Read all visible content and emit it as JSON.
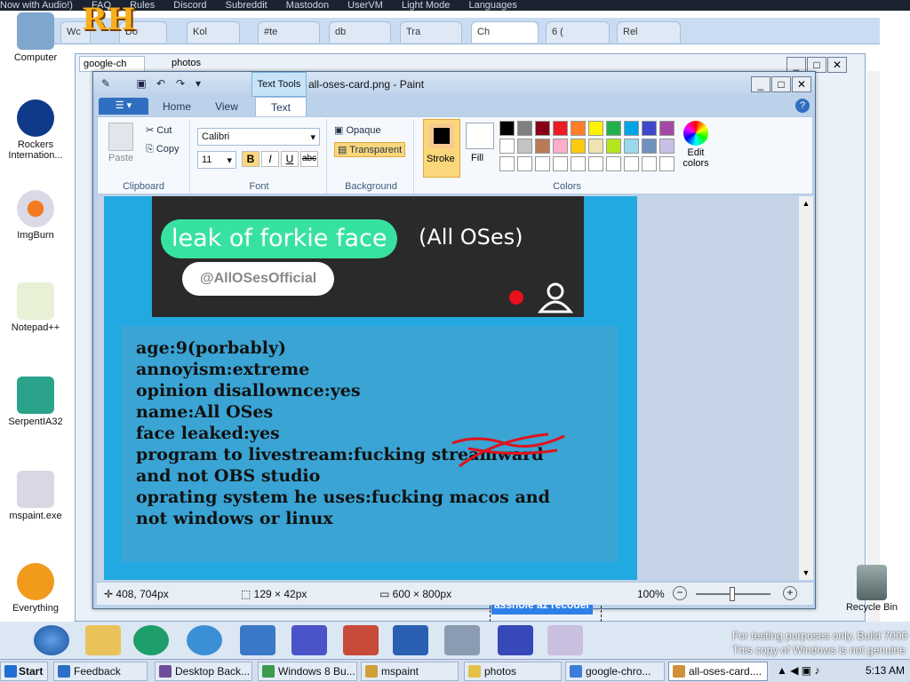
{
  "top_menu": [
    "Now with Audio!)",
    "FAQ",
    "Rules",
    "Discord",
    "Subreddit",
    "Mastodon",
    "UserVM",
    "Light Mode",
    "Languages"
  ],
  "logo_text": "RH",
  "browser_tabs": [
    "Wc",
    "Do",
    "Kol",
    "#te",
    "db",
    "Tra",
    "Ch",
    "6 (",
    "Rel"
  ],
  "desktop_icons": [
    "Computer",
    "Rockers Internation...",
    "ImgBurn",
    "Notepad++",
    "SerpentIA32",
    "mspaint.exe",
    "Everything"
  ],
  "bg_windows": {
    "tab1": "google-ch",
    "tab2": "photos"
  },
  "paint": {
    "title": "all-oses-card.png - Paint",
    "contextual_tab": "Text Tools",
    "tabs": {
      "home": "Home",
      "view": "View",
      "text": "Text"
    },
    "clipboard": {
      "paste": "Paste",
      "cut": "Cut",
      "copy": "Copy",
      "group": "Clipboard"
    },
    "font": {
      "family": "Calibri",
      "size": "11",
      "bold": "B",
      "italic": "I",
      "underline": "U",
      "strike": "abc",
      "group": "Font"
    },
    "background": {
      "opaque": "Opaque",
      "transparent": "Transparent",
      "group": "Background"
    },
    "colors": {
      "stroke": "Stroke",
      "fill": "Fill",
      "edit": "Edit colors",
      "group": "Colors",
      "palette_row1": [
        "#000000",
        "#7f7f7f",
        "#880015",
        "#ed1c24",
        "#ff7f27",
        "#fff200",
        "#22b14c",
        "#00a2e8",
        "#3f48cc",
        "#a349a4"
      ],
      "palette_row2": [
        "#ffffff",
        "#c3c3c3",
        "#b97a57",
        "#ffaec9",
        "#ffc90e",
        "#efe4b0",
        "#b5e61d",
        "#99d9ea",
        "#7092be",
        "#c8bfe7"
      ]
    },
    "image": {
      "video_caption": "leak of forkie face",
      "video_suffix": "(All OSes)",
      "video_handle": "@AllOSesOfficial",
      "card_lines": [
        "age:9(porbably)",
        "annoyism:extreme",
        "opinion disallownce:yes",
        "name:All OSes",
        "face leaked:yes",
        "program to livestream:fucking streamward",
        "and not OBS studio",
        "oprating system he uses:fucking macos and",
        "not windows or linux"
      ],
      "text_box": "asshole az recoder"
    },
    "status": {
      "cursor": "408, 704px",
      "selection": "129 × 42px",
      "size": "600 × 800px",
      "zoom": "100%"
    }
  },
  "recycle_bin": "Recycle Bin",
  "watermark": [
    "For testing purposes only. Build 7000",
    "This copy of Windows is not genuine"
  ],
  "taskbar": {
    "start": "Start",
    "items": [
      "Feedback",
      "Desktop Back...",
      "Windows 8 Bu...",
      "mspaint",
      "photos",
      "google-chro...",
      "all-oses-card...."
    ],
    "clock": "5:13 AM"
  }
}
